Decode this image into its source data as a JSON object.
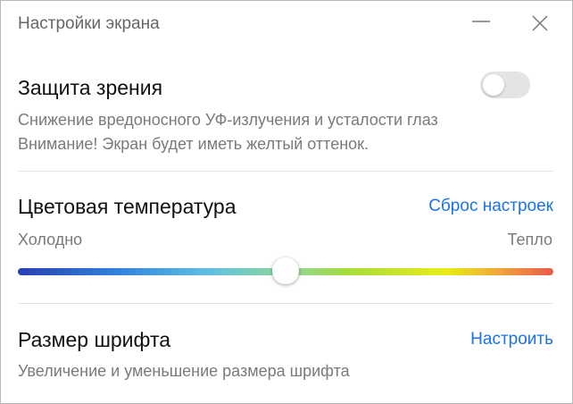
{
  "window": {
    "title": "Настройки экрана",
    "minimize_icon": "minimize-icon",
    "close_icon": "close-icon"
  },
  "eye_protection": {
    "heading": "Защита зрения",
    "enabled": false,
    "description_line1": "Снижение вредоносного УФ-излучения и усталости глаз",
    "description_line2": "Внимание! Экран будет иметь желтый оттенок."
  },
  "color_temperature": {
    "heading": "Цветовая температура",
    "reset_label": "Сброс настроек",
    "cold_label": "Холодно",
    "warm_label": "Тепло",
    "value_fraction": 0.5
  },
  "font_size": {
    "heading": "Размер шрифта",
    "configure_label": "Настроить",
    "description": "Увеличение и уменьшение размера шрифта"
  },
  "colors": {
    "link": "#1a73e8",
    "toggle_off": "#e4e4e4"
  }
}
